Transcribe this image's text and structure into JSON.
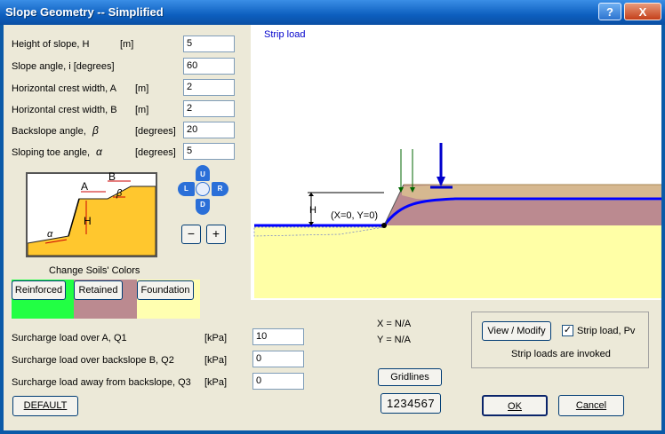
{
  "window": {
    "title": "Slope Geometry -- Simplified",
    "help_label": "?",
    "close_label": "X"
  },
  "geometry": [
    {
      "label": "Height of slope,  H",
      "unit": "[m]",
      "value": "5"
    },
    {
      "label": "Slope angle,  i   [degrees]",
      "unit": "",
      "value": "60"
    },
    {
      "label": "Horizontal crest width,  A",
      "unit": "[m]",
      "value": "2"
    },
    {
      "label": "Horizontal crest width,  B",
      "unit": "[m]",
      "value": "2"
    },
    {
      "label": "Backslope angle,",
      "symbol": "β",
      "unit": "[degrees]",
      "value": "20"
    },
    {
      "label": "Sloping toe angle,",
      "symbol": "α",
      "unit": "[degrees]",
      "value": "5"
    }
  ],
  "sketch_labels": {
    "A": "A",
    "B": "B",
    "H": "H",
    "beta": "β",
    "alpha": "α"
  },
  "nav": {
    "up": "U",
    "down": "D",
    "left": "L",
    "right": "R",
    "zoom_out": "−",
    "zoom_in": "+"
  },
  "soils": {
    "title": "Change Soils' Colors",
    "reinforced": {
      "label": "Reinforced",
      "color": "#22ff44"
    },
    "retained": {
      "label": "Retained",
      "color": "#bb8a90"
    },
    "foundation": {
      "label": "Foundation",
      "color": "#ffffb0"
    }
  },
  "surcharge": [
    {
      "label": "Surcharge load over A,  Q1",
      "unit": "[kPa]",
      "value": "10"
    },
    {
      "label": "Surcharge load over backslope B,  Q2",
      "unit": "[kPa]",
      "value": "0"
    },
    {
      "label": "Surcharge load away from backslope,  Q3",
      "unit": "[kPa]",
      "value": "0"
    }
  ],
  "default_button": "DEFAULT",
  "canvas": {
    "strip_label": "Strip load",
    "origin_label": "(X=0, Y=0)",
    "h_label": "H"
  },
  "coords": {
    "x": "X = N/A",
    "y": "Y = N/A"
  },
  "gridlines_button": "Gridlines",
  "numbers_button": "1234567",
  "strip": {
    "view_modify": "View / Modify",
    "checkbox_label": "Strip load, Pv",
    "checked": "✓",
    "status": "Strip loads are invoked"
  },
  "ok_label": "OK",
  "cancel_label": "Cancel"
}
